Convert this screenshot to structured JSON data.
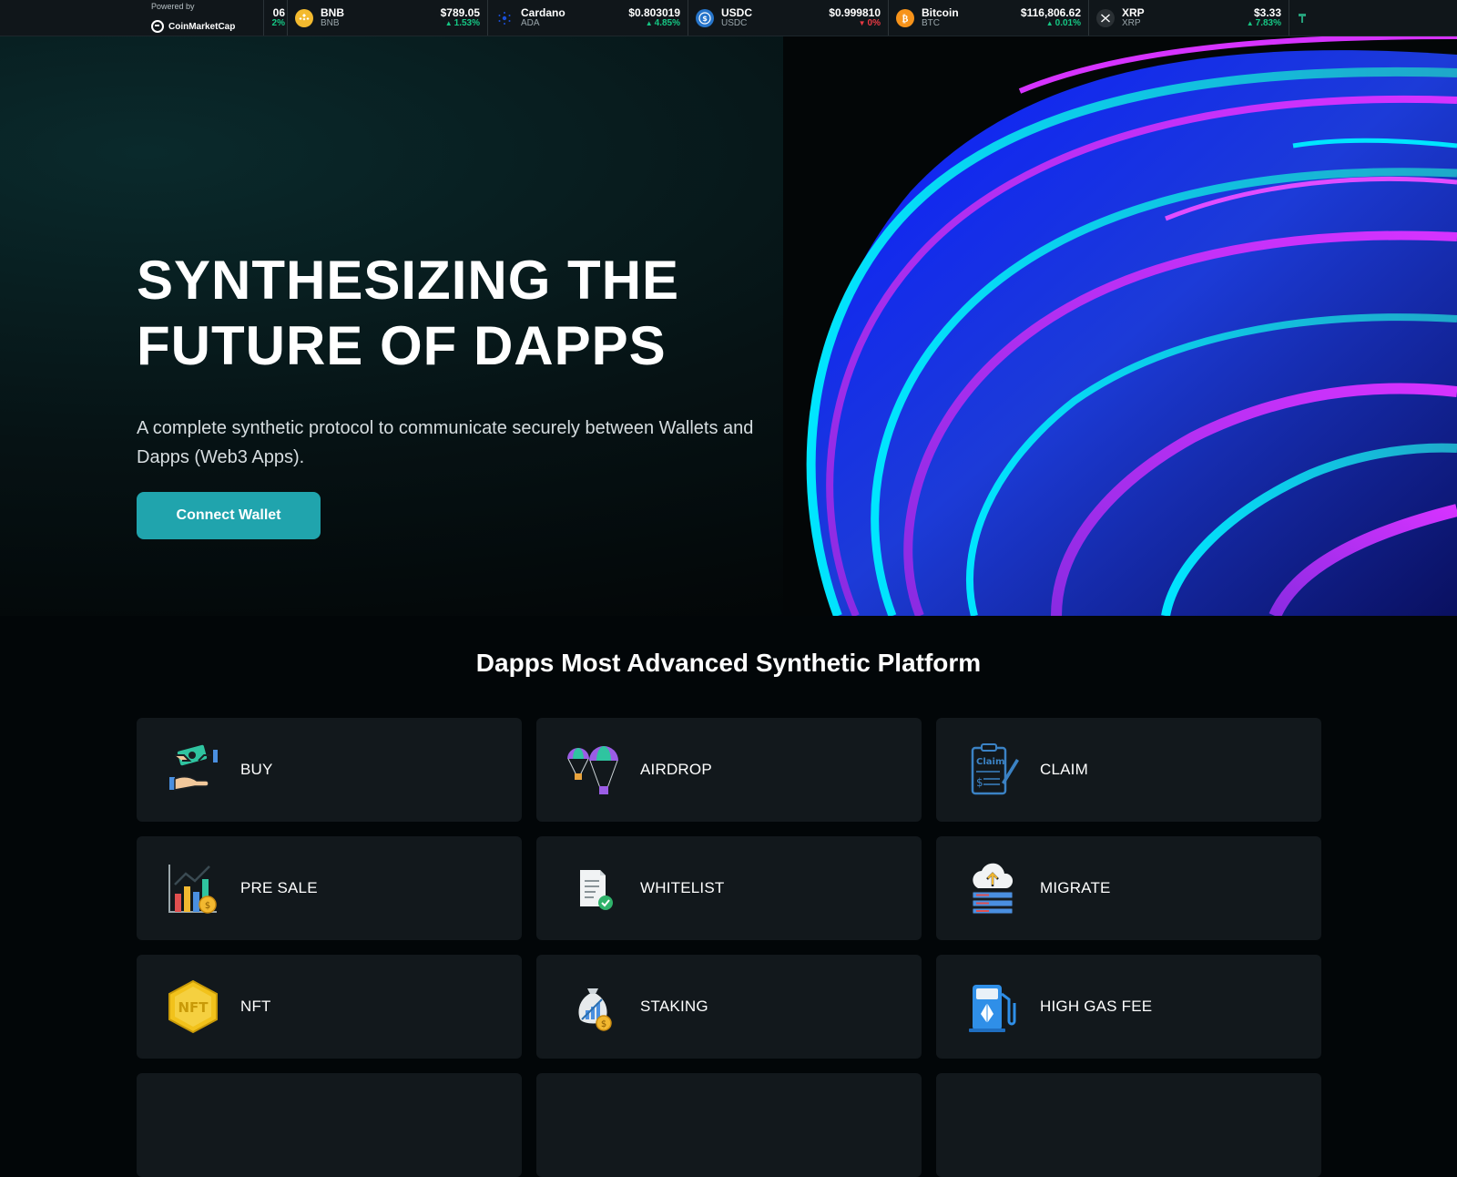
{
  "ticker": {
    "powered_by": "Powered by",
    "brand": "CoinMarketCap",
    "partial": {
      "price": "06",
      "change": "2%"
    },
    "items": [
      {
        "name": "BNB",
        "symbol": "BNB",
        "price": "$789.05",
        "change": "1.53%",
        "dir": "up",
        "icon": "bnb-coin-icon",
        "color": "#f3ba2f"
      },
      {
        "name": "Cardano",
        "symbol": "ADA",
        "price": "$0.803019",
        "change": "4.85%",
        "dir": "up",
        "icon": "cardano-coin-icon",
        "color": "#0033ad"
      },
      {
        "name": "USDC",
        "symbol": "USDC",
        "price": "$0.999810",
        "change": "0%",
        "dir": "down",
        "icon": "usdc-coin-icon",
        "color": "#2775ca"
      },
      {
        "name": "Bitcoin",
        "symbol": "BTC",
        "price": "$116,806.62",
        "change": "0.01%",
        "dir": "up",
        "icon": "bitcoin-coin-icon",
        "color": "#f7931a"
      },
      {
        "name": "XRP",
        "symbol": "XRP",
        "price": "$3.33",
        "change": "7.83%",
        "dir": "up",
        "icon": "xrp-coin-icon",
        "color": "#23292f"
      }
    ]
  },
  "hero": {
    "title_line1": "SYNTHESIZING THE",
    "title_line2": "FUTURE OF DAPPS",
    "subtitle": "A complete synthetic protocol to communicate securely between Wallets and Dapps (Web3 Apps).",
    "cta_label": "Connect Wallet"
  },
  "features": {
    "title": "Dapps Most Advanced Synthetic Platform",
    "items": [
      {
        "label": "BUY",
        "icon": "handshake-money-icon"
      },
      {
        "label": "AIRDROP",
        "icon": "parachute-icon"
      },
      {
        "label": "CLAIM",
        "icon": "claim-form-icon"
      },
      {
        "label": "PRE SALE",
        "icon": "bar-chart-coin-icon"
      },
      {
        "label": "WHITELIST",
        "icon": "document-check-icon"
      },
      {
        "label": "MIGRATE",
        "icon": "cloud-upload-server-icon"
      },
      {
        "label": "NFT",
        "icon": "nft-hexagon-icon"
      },
      {
        "label": "STAKING",
        "icon": "money-bag-chart-icon"
      },
      {
        "label": "HIGH GAS FEE",
        "icon": "gas-pump-icon"
      },
      {
        "label": "",
        "icon": ""
      },
      {
        "label": "",
        "icon": ""
      },
      {
        "label": "",
        "icon": ""
      }
    ]
  },
  "colors": {
    "accent": "#20a4ad",
    "up": "#16c784",
    "down": "#ea3943",
    "card": "#12181c"
  }
}
